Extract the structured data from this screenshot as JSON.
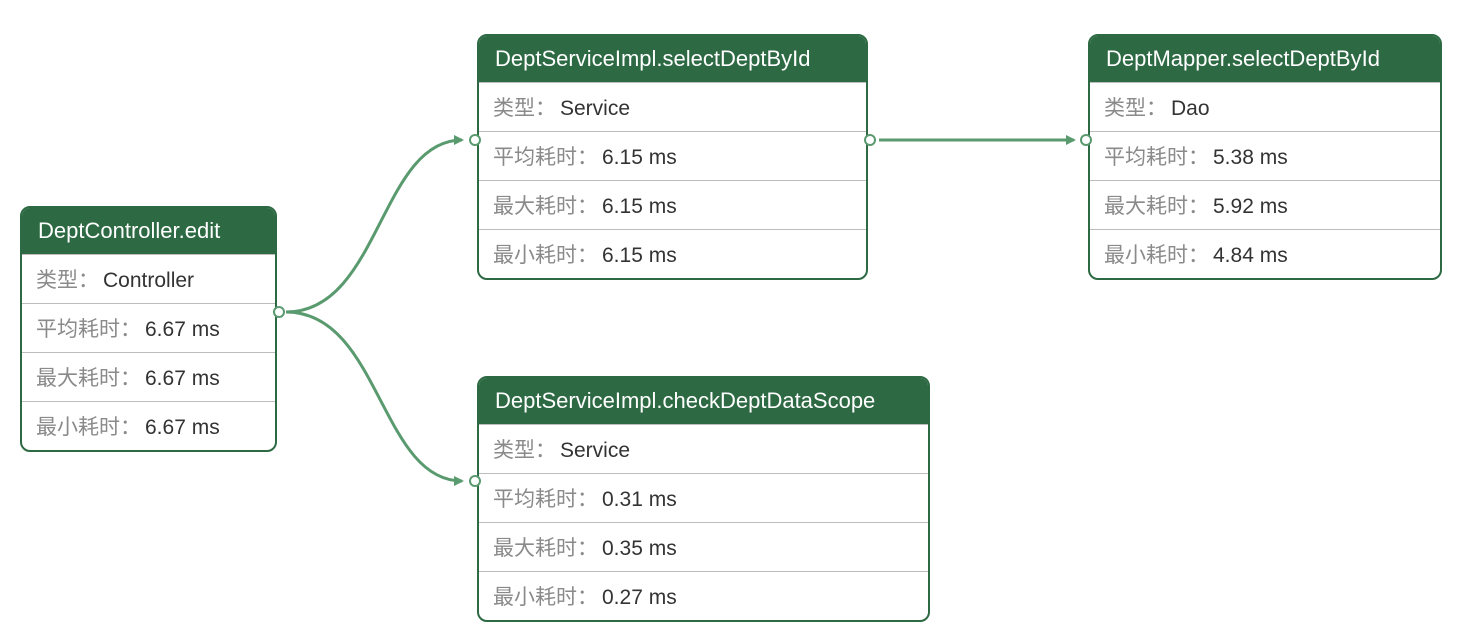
{
  "labels": {
    "type": "类型：",
    "avg": "平均耗时：",
    "max": "最大耗时：",
    "min": "最小耗时："
  },
  "nodes": {
    "n0": {
      "title": "DeptController.edit",
      "type": "Controller",
      "avg": "6.67 ms",
      "max": "6.67 ms",
      "min": "6.67 ms"
    },
    "n1": {
      "title": "DeptServiceImpl.selectDeptById",
      "type": "Service",
      "avg": "6.15 ms",
      "max": "6.15 ms",
      "min": "6.15 ms"
    },
    "n2": {
      "title": "DeptMapper.selectDeptById",
      "type": "Dao",
      "avg": "5.38 ms",
      "max": "5.92 ms",
      "min": "4.84 ms"
    },
    "n3": {
      "title": "DeptServiceImpl.checkDeptDataScope",
      "type": "Service",
      "avg": "0.31 ms",
      "max": "0.35 ms",
      "min": "0.27 ms"
    }
  },
  "colors": {
    "node_border": "#2d6a43",
    "title_bg": "#2d6a43",
    "edge": "#5a9a6f",
    "label_text": "#8a8a8a",
    "value_text": "#333333"
  }
}
